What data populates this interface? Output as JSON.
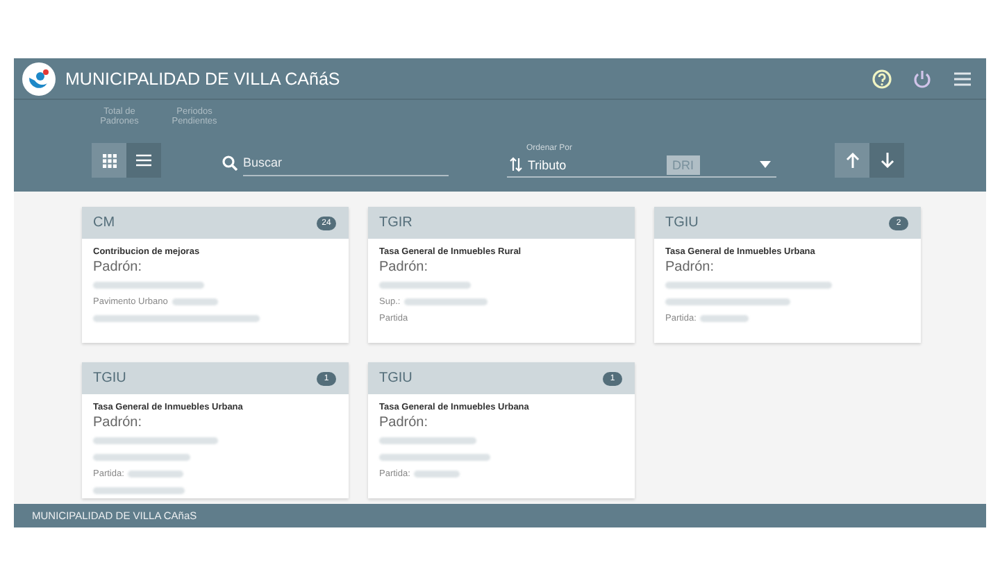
{
  "top_bar": {
    "title": "MUNICIPALIDAD DE VILLA CAñáS"
  },
  "stats": [
    {
      "label": "Total de Padrones"
    },
    {
      "label": "Periodos Pendientes"
    }
  ],
  "view_toggle": [
    {
      "kind": "grid",
      "selected": true
    },
    {
      "kind": "list",
      "selected": false
    }
  ],
  "search": {
    "placeholder": "Buscar"
  },
  "sort": {
    "label": "Ordenar Por",
    "value": "Tributo",
    "chip": "DRI"
  },
  "direction": [
    {
      "kind": "up",
      "selected": true
    },
    {
      "kind": "down",
      "selected": false
    }
  ],
  "cards": [
    {
      "code": "CM",
      "badge": "24",
      "description": "Contribucion de mejoras",
      "padron": "Padrón:",
      "lines": [
        {
          "kind": "blur"
        },
        {
          "kind": "labeled",
          "text": "Pavimento Urbano"
        },
        {
          "kind": "blur"
        }
      ]
    },
    {
      "code": "TGIR",
      "description": "Tasa General de Inmuebles Rural",
      "padron": "Padrón:",
      "lines": [
        {
          "kind": "blur"
        },
        {
          "kind": "labeled",
          "text": "Sup.:"
        },
        {
          "kind": "text",
          "text": "Partida"
        }
      ]
    },
    {
      "code": "TGIU",
      "badge": "2",
      "description": "Tasa General de Inmuebles Urbana",
      "padron": "Padrón:",
      "lines": [
        {
          "kind": "blur"
        },
        {
          "kind": "blur"
        },
        {
          "kind": "labeled",
          "text": "Partida:"
        }
      ]
    },
    {
      "code": "TGIU",
      "badge": "1",
      "description": "Tasa General de Inmuebles Urbana",
      "padron": "Padrón:",
      "lines": [
        {
          "kind": "blur"
        },
        {
          "kind": "blur"
        },
        {
          "kind": "labeled",
          "text": "Partida:"
        },
        {
          "kind": "blur"
        }
      ]
    },
    {
      "code": "TGIU",
      "badge": "1",
      "description": "Tasa General de Inmuebles Urbana",
      "padron": "Padrón:",
      "lines": [
        {
          "kind": "blur"
        },
        {
          "kind": "blur"
        },
        {
          "kind": "labeled",
          "text": "Partida:"
        }
      ]
    }
  ],
  "footer": {
    "text": "MUNICIPALIDAD DE VILLA CAñaS"
  }
}
